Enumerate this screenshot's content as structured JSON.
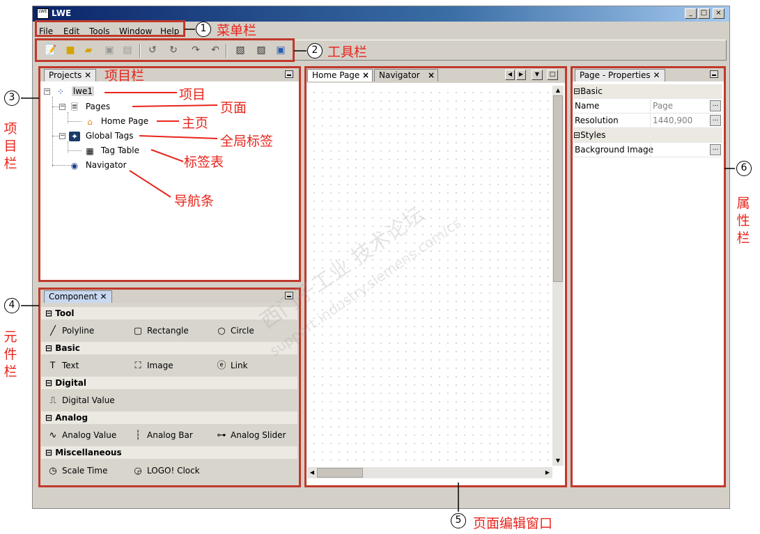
{
  "window": {
    "title": "LWE",
    "logo": "LWE",
    "controls": [
      "_",
      "□",
      "×"
    ]
  },
  "menu": [
    "File",
    "Edit",
    "Tools",
    "Window",
    "Help"
  ],
  "projects_panel": {
    "tab": "Projects",
    "tree": {
      "root": "lwe1",
      "pages": "Pages",
      "home_page": "Home Page",
      "global_tags": "Global Tags",
      "tag_table": "Tag Table",
      "navigator": "Navigator"
    }
  },
  "component_panel": {
    "tab": "Component",
    "groups": [
      {
        "name": "Tool",
        "items": [
          {
            "label": "Polyline",
            "icon": "polyline-icon"
          },
          {
            "label": "Rectangle",
            "icon": "rectangle-icon"
          },
          {
            "label": "Circle",
            "icon": "circle-icon"
          }
        ]
      },
      {
        "name": "Basic",
        "items": [
          {
            "label": "Text",
            "icon": "text-icon"
          },
          {
            "label": "Image",
            "icon": "image-icon"
          },
          {
            "label": "Link",
            "icon": "link-icon"
          }
        ]
      },
      {
        "name": "Digital",
        "items": [
          {
            "label": "Digital Value",
            "icon": "digital-value-icon"
          }
        ]
      },
      {
        "name": "Analog",
        "items": [
          {
            "label": "Analog Value",
            "icon": "analog-value-icon"
          },
          {
            "label": "Analog Bar",
            "icon": "analog-bar-icon"
          },
          {
            "label": "Analog Slider",
            "icon": "analog-slider-icon"
          }
        ]
      },
      {
        "name": "Miscellaneous",
        "items": [
          {
            "label": "Scale Time",
            "icon": "clock-icon"
          },
          {
            "label": "LOGO! Clock",
            "icon": "logo-clock-icon"
          }
        ]
      }
    ]
  },
  "editor": {
    "tabs": [
      "Home Page",
      "Navigator"
    ],
    "close": "×"
  },
  "properties_panel": {
    "tab": "Page - Properties",
    "categories": [
      {
        "name": "Basic",
        "rows": [
          {
            "name": "Name",
            "value": "Page"
          },
          {
            "name": "Resolution",
            "value": "1440,900"
          }
        ]
      },
      {
        "name": "Styles",
        "rows": [
          {
            "name": "Background Image",
            "value": ""
          }
        ]
      }
    ],
    "ellipsis": "..."
  },
  "annotations": {
    "menubar": "菜单栏",
    "toolbar": "工具栏",
    "project_bar": "项目栏",
    "project": "项目",
    "page": "页面",
    "home": "主页",
    "global_tags": "全局标签",
    "tag_table": "标签表",
    "navbar": "导航条",
    "project_bar_vertical": "项目栏",
    "component_bar_vertical": "元件栏",
    "properties_bar_vertical": "属性栏",
    "editor_window": "页面编辑窗口",
    "numbers": [
      "1",
      "2",
      "3",
      "4",
      "5",
      "6"
    ]
  },
  "watermark": {
    "line1": "西门子工业  技术论坛",
    "line2": "support.industry.siemens.com/cs"
  },
  "colors": {
    "annotation_red": "#e8251c",
    "frame_red": "#c0392b",
    "title_blue": "#0a246a"
  }
}
